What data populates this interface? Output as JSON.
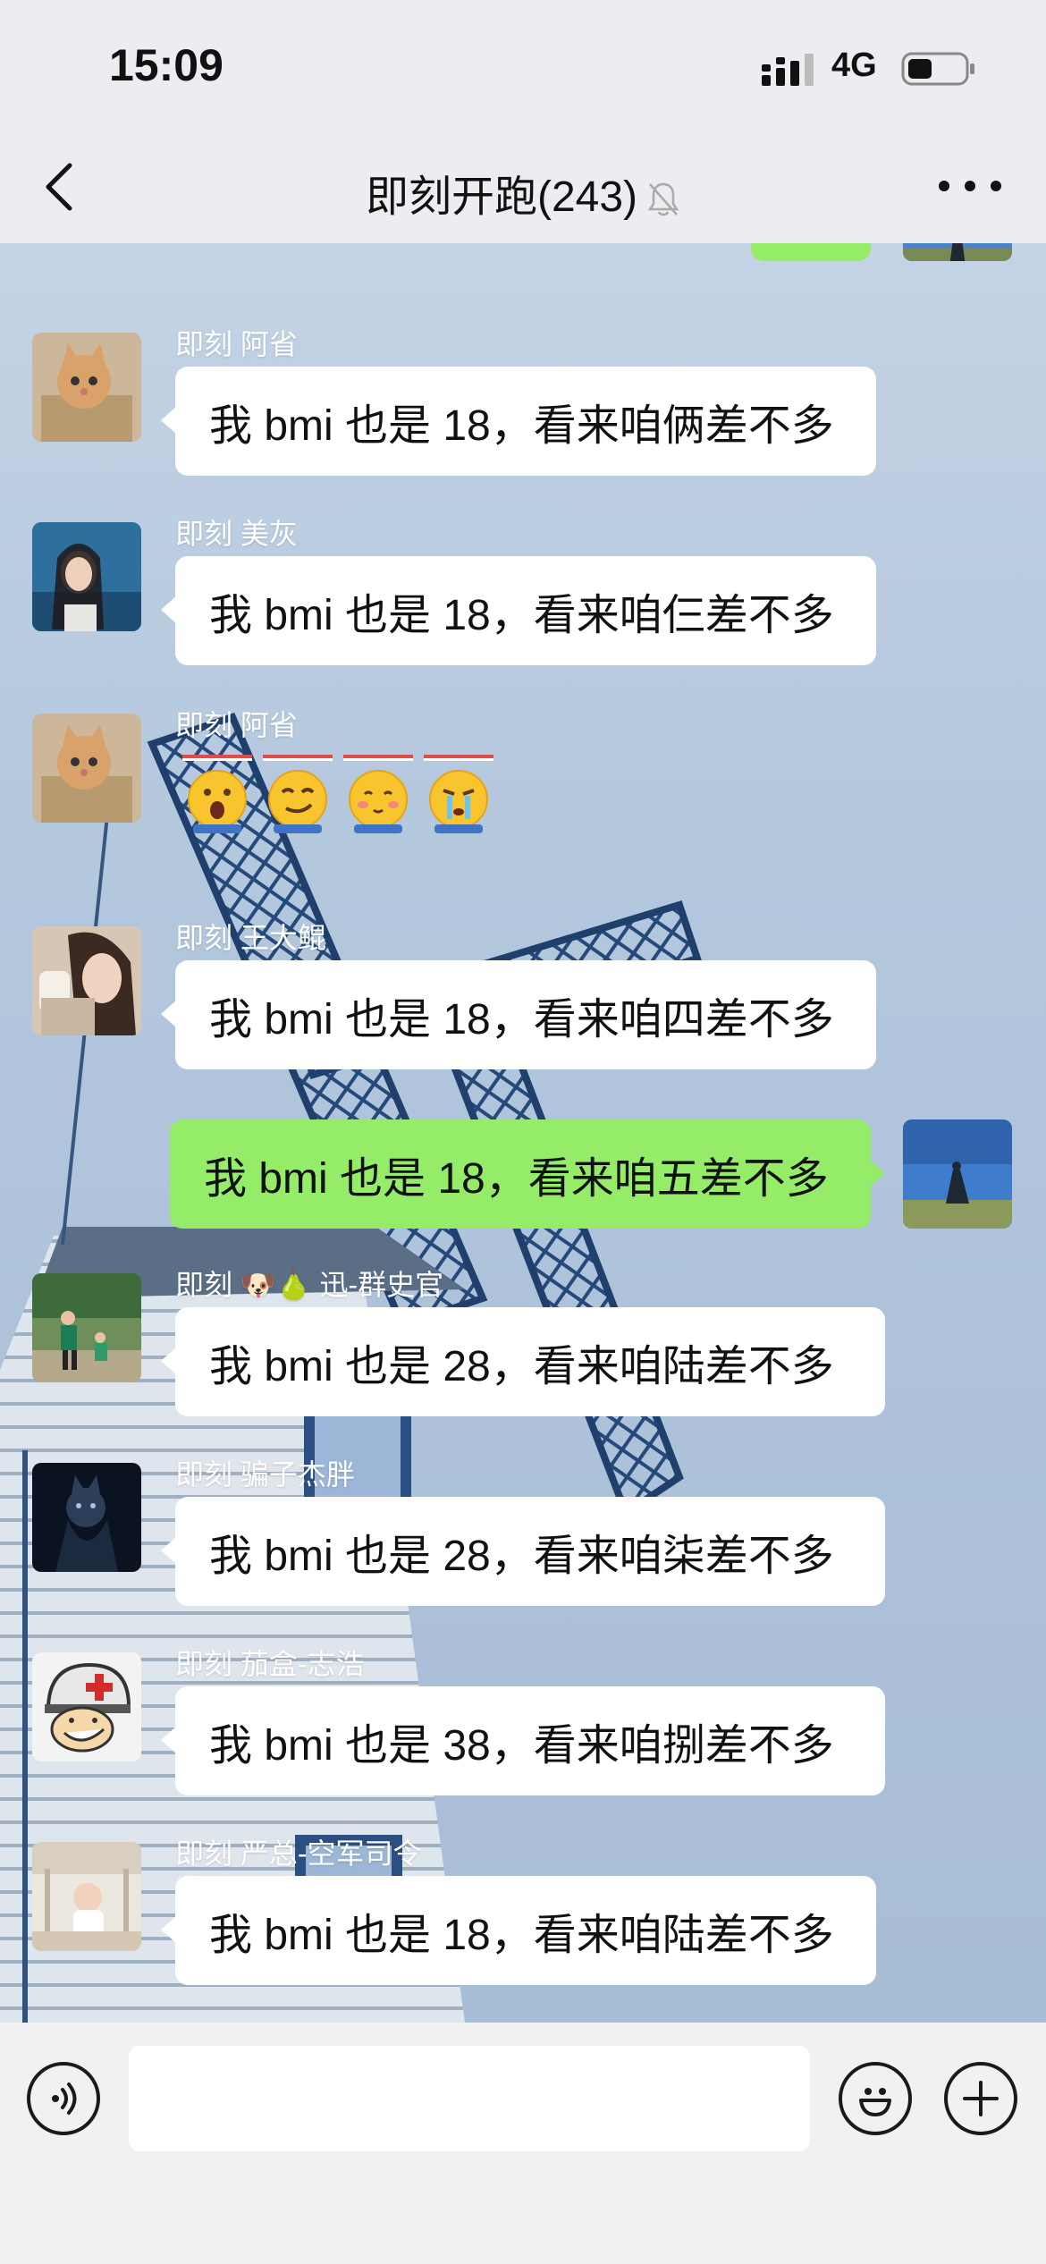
{
  "status_bar": {
    "time": "15:09",
    "network": "4G"
  },
  "header": {
    "title": "即刻开跑(243)"
  },
  "messages": [
    {
      "type": "incoming",
      "sender": "即刻 阿省",
      "text": "我 bmi 也是 18，看来咱俩差不多"
    },
    {
      "type": "incoming",
      "sender": "即刻 美灰",
      "text": "我 bmi 也是 18，看来咱仨差不多"
    },
    {
      "type": "incoming_sticker",
      "sender": "即刻 阿省",
      "stickers": [
        "mouth-open-face-icon",
        "smirk-face-icon",
        "blush-face-icon",
        "crying-face-icon"
      ]
    },
    {
      "type": "incoming",
      "sender": "即刻 王大鲲",
      "text": "我 bmi 也是 18，看来咱四差不多"
    },
    {
      "type": "outgoing",
      "text": "我 bmi 也是 18，看来咱五差不多"
    },
    {
      "type": "incoming",
      "sender": "即刻 🐶🍐 迅-群史官",
      "text": "我 bmi 也是 28，看来咱陆差不多"
    },
    {
      "type": "incoming",
      "sender": "即刻 骗子杰胖",
      "text": "我 bmi 也是 28，看来咱柒差不多"
    },
    {
      "type": "incoming",
      "sender": "即刻 茄盒-志浩",
      "text": "我 bmi 也是 38，看来咱捌差不多"
    },
    {
      "type": "incoming",
      "sender": "即刻 严总-空军司令",
      "text": "我 bmi 也是 18，看来咱陆差不多"
    }
  ],
  "input_bar": {
    "placeholder": "",
    "voice_icon": "voice-icon",
    "emoji_icon": "emoji-icon",
    "plus_icon": "plus-icon"
  },
  "colors": {
    "outgoing_bubble": "#95ec69",
    "incoming_bubble": "#ffffff",
    "bar_background": "#ececf1"
  }
}
